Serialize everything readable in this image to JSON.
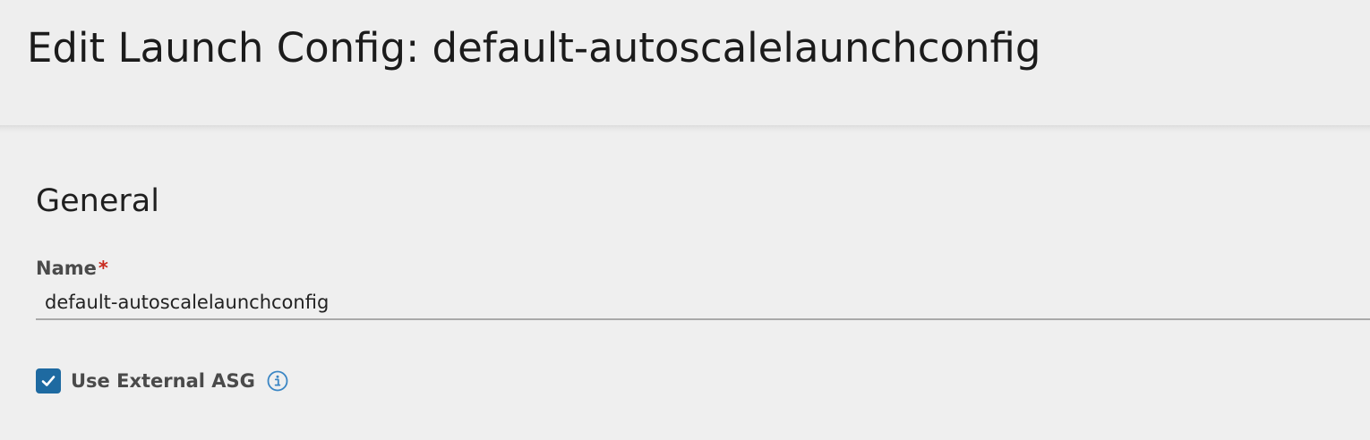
{
  "header": {
    "title": "Edit Launch Config: default-autoscalelaunchconfig"
  },
  "general": {
    "section_title": "General",
    "name_field": {
      "label": "Name",
      "required_mark": "*",
      "value": "default-autoscalelaunchconfig"
    },
    "external_asg": {
      "label": "Use External ASG",
      "checked": true,
      "info_icon": "info-circle-icon"
    }
  },
  "colors": {
    "accent": "#1e6aa1",
    "required": "#c92a1e",
    "background": "#eeeeee"
  }
}
